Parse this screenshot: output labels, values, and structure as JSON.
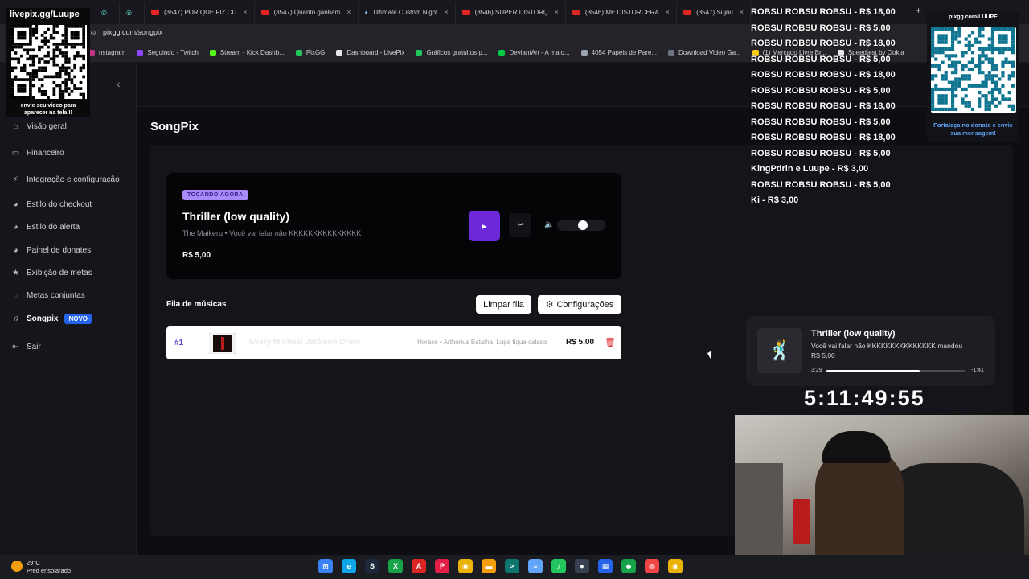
{
  "browser": {
    "tabs": [
      {
        "label": "",
        "type": "icon"
      },
      {
        "label": "",
        "type": "icon"
      },
      {
        "label": "(3547) POR QUE FIZ CU",
        "type": "yt"
      },
      {
        "label": "(3547) Quanto ganham",
        "type": "yt"
      },
      {
        "label": "Ultimate Custom Night",
        "type": "steam"
      },
      {
        "label": "(3546) SUPER DISTORÇ",
        "type": "yt"
      },
      {
        "label": "(3546) ME DISTORCERA",
        "type": "yt"
      },
      {
        "label": "(3547) Sujou",
        "type": "yt"
      }
    ],
    "url": "pixgg.com/songpix",
    "bookmarks": [
      {
        "label": "nstagram",
        "color": "#c13584"
      },
      {
        "label": "Seguindo - Twitch",
        "color": "#9146ff"
      },
      {
        "label": "Stream - Kick Dashb...",
        "color": "#53fc18"
      },
      {
        "label": "PixGG",
        "color": "#22c55e"
      },
      {
        "label": "Dashboard - LivePix",
        "color": "#e5e7eb"
      },
      {
        "label": "Gráficos gratuitos p...",
        "color": "#22c55e"
      },
      {
        "label": "DeviantArt - A maio...",
        "color": "#05cc47"
      },
      {
        "label": "4054 Papéis de Pare...",
        "color": "#9ca3af"
      },
      {
        "label": "Download Video Ga...",
        "color": "#6b7280"
      },
      {
        "label": "(1) Mercado Livre Br...",
        "color": "#facc15"
      },
      {
        "label": "Speedtest by Ookla",
        "color": "#e5e7eb"
      }
    ]
  },
  "sidebar": {
    "items": [
      {
        "label": "Visão geral",
        "icon": "home-icon"
      },
      {
        "label": "Financeiro",
        "icon": "wallet-icon"
      },
      {
        "label": "Integração e configuração",
        "icon": "plug-icon"
      },
      {
        "label": "Estilo do checkout",
        "icon": "palette-icon"
      },
      {
        "label": "Estilo do alerta",
        "icon": "palette-icon"
      },
      {
        "label": "Painel de donates",
        "icon": "palette-icon"
      },
      {
        "label": "Exibição de metas",
        "icon": "star-icon"
      },
      {
        "label": "Metas conjuntas",
        "icon": "chat-icon"
      },
      {
        "label": "Songpix",
        "icon": "music-icon",
        "badge": "NOVO"
      },
      {
        "label": "Sair",
        "icon": "logout-icon"
      }
    ]
  },
  "main": {
    "page_title": "SongPix",
    "player": {
      "badge": "TOCANDO AGORA",
      "title": "Thriller (low quality)",
      "subtitle": "The Maikeru • Você vai falar não KKKKKKKKKKKKKKK",
      "price": "R$ 5,00",
      "volume_level": 0.45
    },
    "queue": {
      "title": "Fila de músicas",
      "clear_label": "Limpar fila",
      "config_label": "Configurações",
      "rows": [
        {
          "number": "#1",
          "song": "Every Michael Jackson Drum",
          "artist": "Horace • Arthorius Batalha, Lupe fique calado",
          "price": "R$ 5,00"
        }
      ]
    }
  },
  "overlays": {
    "qr_left": {
      "header": "livepix.gg/Luupe",
      "caption": "envie seu vídeo para aparecer na tela !!"
    },
    "donations": [
      "ROBSU ROBSU ROBSU - R$ 18,00",
      "ROBSU ROBSU ROBSU - R$ 5,00",
      "ROBSU ROBSU ROBSU - R$ 18,00",
      "ROBSU ROBSU ROBSU - R$ 5,00",
      "ROBSU ROBSU ROBSU - R$ 18,00",
      "ROBSU ROBSU ROBSU - R$ 5,00",
      "ROBSU ROBSU ROBSU - R$ 18,00",
      "ROBSU ROBSU ROBSU - R$ 5,00",
      "ROBSU ROBSU ROBSU - R$ 18,00",
      "ROBSU ROBSU ROBSU - R$ 5,00",
      "KingPdrin e Luupe - R$ 3,00",
      "ROBSU ROBSU ROBSU - R$ 5,00",
      "Ki - R$ 3,00"
    ],
    "qr_right": {
      "url": "pixgg.com/LUUPE",
      "caption": "Fortaleça no donate e envie sua mensagem!"
    },
    "now_playing": {
      "title": "Thriller (low quality)",
      "message": "Você vai falar não KKKKKKKKKKKKKKK mandou",
      "price": "R$ 5,00",
      "elapsed": "3:29",
      "remaining": "-1:41",
      "progress": 0.67
    },
    "timer": "5:11:49:55"
  },
  "taskbar": {
    "weather_temp": "29°C",
    "weather_desc": "Pred ensolarado",
    "apps": [
      {
        "name": "windows-start-icon",
        "color": "#3b82f6",
        "glyph": "⊞"
      },
      {
        "name": "edge-icon",
        "color": "#0ea5e9",
        "glyph": "e"
      },
      {
        "name": "steam-icon",
        "color": "#1e293b",
        "glyph": "S"
      },
      {
        "name": "xbox-icon",
        "color": "#16a34a",
        "glyph": "X"
      },
      {
        "name": "acrobat-icon",
        "color": "#dc2626",
        "glyph": "A"
      },
      {
        "name": "pinterest-icon",
        "color": "#e11d48",
        "glyph": "P"
      },
      {
        "name": "chrome-icon",
        "color": "#eab308",
        "glyph": "◉"
      },
      {
        "name": "folder-icon",
        "color": "#f59e0b",
        "glyph": "▬"
      },
      {
        "name": "terminal-icon",
        "color": "#0f766e",
        "glyph": ">"
      },
      {
        "name": "notepad-icon",
        "color": "#60a5fa",
        "glyph": "≡"
      },
      {
        "name": "spotify-icon",
        "color": "#22c55e",
        "glyph": "♪"
      },
      {
        "name": "obs-icon",
        "color": "#374151",
        "glyph": "●"
      },
      {
        "name": "app-icon",
        "color": "#2563eb",
        "glyph": "▦"
      },
      {
        "name": "app2-icon",
        "color": "#16a34a",
        "glyph": "◆"
      },
      {
        "name": "app3-icon",
        "color": "#ef4444",
        "glyph": "◍"
      },
      {
        "name": "chrome2-icon",
        "color": "#eab308",
        "glyph": "◉"
      }
    ]
  },
  "colors": {
    "accent": "#6d28d9",
    "badge": "#a78bfa",
    "delete": "#dc2626",
    "novo": "#2563eb"
  }
}
